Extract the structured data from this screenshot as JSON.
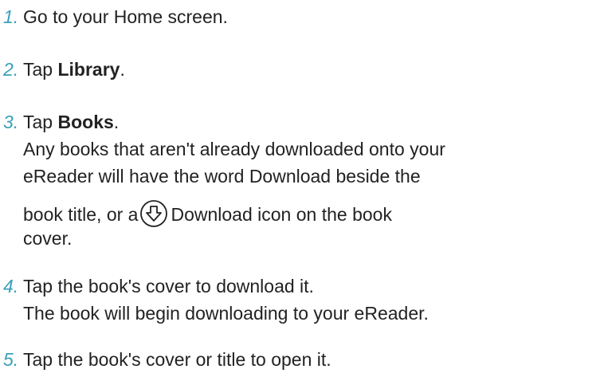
{
  "steps": [
    {
      "number": "1.",
      "text": "Go to your Home screen."
    },
    {
      "number": "2.",
      "prefix": "Tap ",
      "bold": "Library",
      "suffix": "."
    },
    {
      "number": "3.",
      "prefix": "Tap ",
      "bold": "Books",
      "suffix": ".",
      "detail_line1": "Any books that aren't already downloaded onto your",
      "detail_line2": "eReader will have the word Download beside the",
      "detail_line3_before_icon": "book title, or a",
      "detail_line3_after_icon": "Download icon on the book",
      "detail_line4": "cover.",
      "icon": "download-circle-arrow-icon"
    },
    {
      "number": "4.",
      "text": "Tap the book's cover to download it.",
      "detail": "The book will begin downloading to your eReader."
    },
    {
      "number": "5.",
      "text": "Tap the book's cover or title to open it."
    }
  ],
  "colors": {
    "step_number": "#3aa0b8",
    "text": "#222222"
  }
}
